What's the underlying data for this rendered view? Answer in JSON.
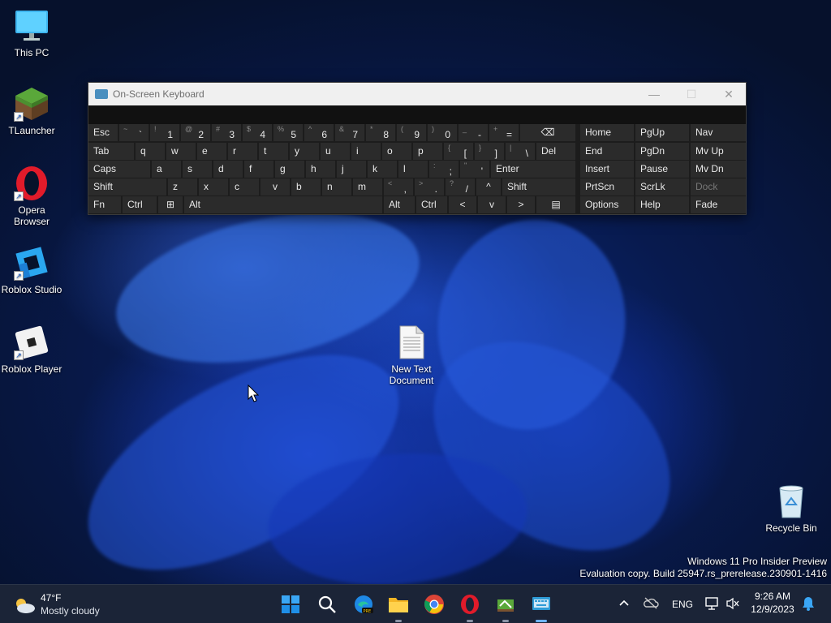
{
  "desktop": {
    "icons": [
      {
        "label": "This PC",
        "icon": "computer-icon"
      },
      {
        "label": "TLauncher",
        "icon": "minecraft-grass-block-icon"
      },
      {
        "label": "Opera Browser",
        "icon": "opera-icon"
      },
      {
        "label": "Roblox Studio",
        "icon": "roblox-studio-icon"
      },
      {
        "label": "Roblox Player",
        "icon": "roblox-player-icon"
      },
      {
        "label": "New Text Document",
        "icon": "text-document-icon"
      },
      {
        "label": "Recycle Bin",
        "icon": "recycle-bin-icon"
      }
    ],
    "watermark": {
      "line1": "Windows 11 Pro Insider Preview",
      "line2": "Evaluation copy. Build 25947.rs_prerelease.230901-1416"
    }
  },
  "osk": {
    "title": "On-Screen Keyboard",
    "rows": [
      [
        {
          "main": "Esc"
        },
        {
          "shift": "~",
          "main": "`"
        },
        {
          "shift": "!",
          "main": "1"
        },
        {
          "shift": "@",
          "main": "2"
        },
        {
          "shift": "#",
          "main": "3"
        },
        {
          "shift": "$",
          "main": "4"
        },
        {
          "shift": "%",
          "main": "5"
        },
        {
          "shift": "^",
          "main": "6"
        },
        {
          "shift": "&",
          "main": "7"
        },
        {
          "shift": "*",
          "main": "8"
        },
        {
          "shift": "(",
          "main": "9"
        },
        {
          "shift": ")",
          "main": "0"
        },
        {
          "shift": "_",
          "main": "-"
        },
        {
          "shift": "+",
          "main": "="
        },
        {
          "main": "⌫"
        }
      ],
      [
        {
          "main": "Tab"
        },
        {
          "main": "q"
        },
        {
          "main": "w"
        },
        {
          "main": "e"
        },
        {
          "main": "r"
        },
        {
          "main": "t"
        },
        {
          "main": "y"
        },
        {
          "main": "u"
        },
        {
          "main": "i"
        },
        {
          "main": "o"
        },
        {
          "main": "p"
        },
        {
          "shift": "{",
          "main": "["
        },
        {
          "shift": "}",
          "main": "]"
        },
        {
          "shift": "|",
          "main": "\\"
        },
        {
          "main": "Del"
        }
      ],
      [
        {
          "main": "Caps"
        },
        {
          "main": "a"
        },
        {
          "main": "s"
        },
        {
          "main": "d"
        },
        {
          "main": "f"
        },
        {
          "main": "g"
        },
        {
          "main": "h"
        },
        {
          "main": "j"
        },
        {
          "main": "k"
        },
        {
          "main": "l"
        },
        {
          "shift": ":",
          "main": ";"
        },
        {
          "shift": "\"",
          "main": "'"
        },
        {
          "main": "Enter"
        }
      ],
      [
        {
          "main": "Shift"
        },
        {
          "main": "z"
        },
        {
          "main": "x"
        },
        {
          "main": "c"
        },
        {
          "main": "v"
        },
        {
          "main": "b"
        },
        {
          "main": "n"
        },
        {
          "main": "m"
        },
        {
          "shift": "<",
          "main": ","
        },
        {
          "shift": ">",
          "main": "."
        },
        {
          "shift": "?",
          "main": "/"
        },
        {
          "main": "^"
        },
        {
          "main": "Shift"
        }
      ],
      [
        {
          "main": "Fn"
        },
        {
          "main": "Ctrl"
        },
        {
          "main": "⊞"
        },
        {
          "main": "Alt"
        },
        {
          "main": ""
        },
        {
          "main": "Alt"
        },
        {
          "main": "Ctrl"
        },
        {
          "main": "<"
        },
        {
          "main": "v"
        },
        {
          "main": ">"
        },
        {
          "main": "▤"
        }
      ]
    ],
    "nav_rows": [
      [
        "Home",
        "PgUp",
        "Nav"
      ],
      [
        "End",
        "PgDn",
        "Mv Up"
      ],
      [
        "Insert",
        "Pause",
        "Mv Dn"
      ],
      [
        "PrtScn",
        "ScrLk",
        "Dock"
      ],
      [
        "Options",
        "Help",
        "Fade"
      ]
    ]
  },
  "taskbar": {
    "weather": {
      "temp": "47°F",
      "condition": "Mostly cloudy"
    },
    "apps": [
      "start-icon",
      "search-icon",
      "edge-beta-icon",
      "file-explorer-icon",
      "chrome-icon",
      "opera-icon",
      "tlauncher-icon",
      "on-screen-keyboard-icon"
    ],
    "tray": {
      "language": "ENG",
      "time": "9:26 AM",
      "date": "12/9/2023"
    }
  }
}
